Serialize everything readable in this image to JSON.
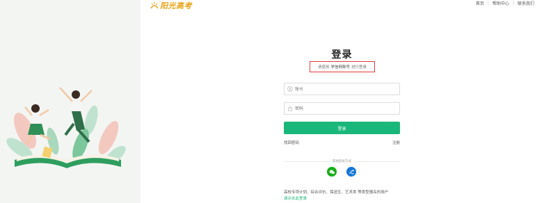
{
  "brand": {
    "name": "阳光高考"
  },
  "nav": {
    "home": "首页",
    "help": "帮助中心",
    "contact": "联系我们"
  },
  "login": {
    "title": "登录",
    "hint_prefix": "请使用",
    "hint_account": "学信网账号",
    "hint_suffix": "进行登录",
    "account_placeholder": "账号",
    "password_placeholder": "密码",
    "submit": "登录",
    "forgot": "找回密码",
    "register": "注册",
    "other_methods": "其他登录方式",
    "notice": "高校专项计划、综合评价、保送生、艺术类 等类型报名的用户",
    "notice_link": "请点击此登录"
  },
  "colors": {
    "accent": "#1ab77a",
    "highlight_box": "#e03a3a",
    "logo": "#e8a317"
  }
}
